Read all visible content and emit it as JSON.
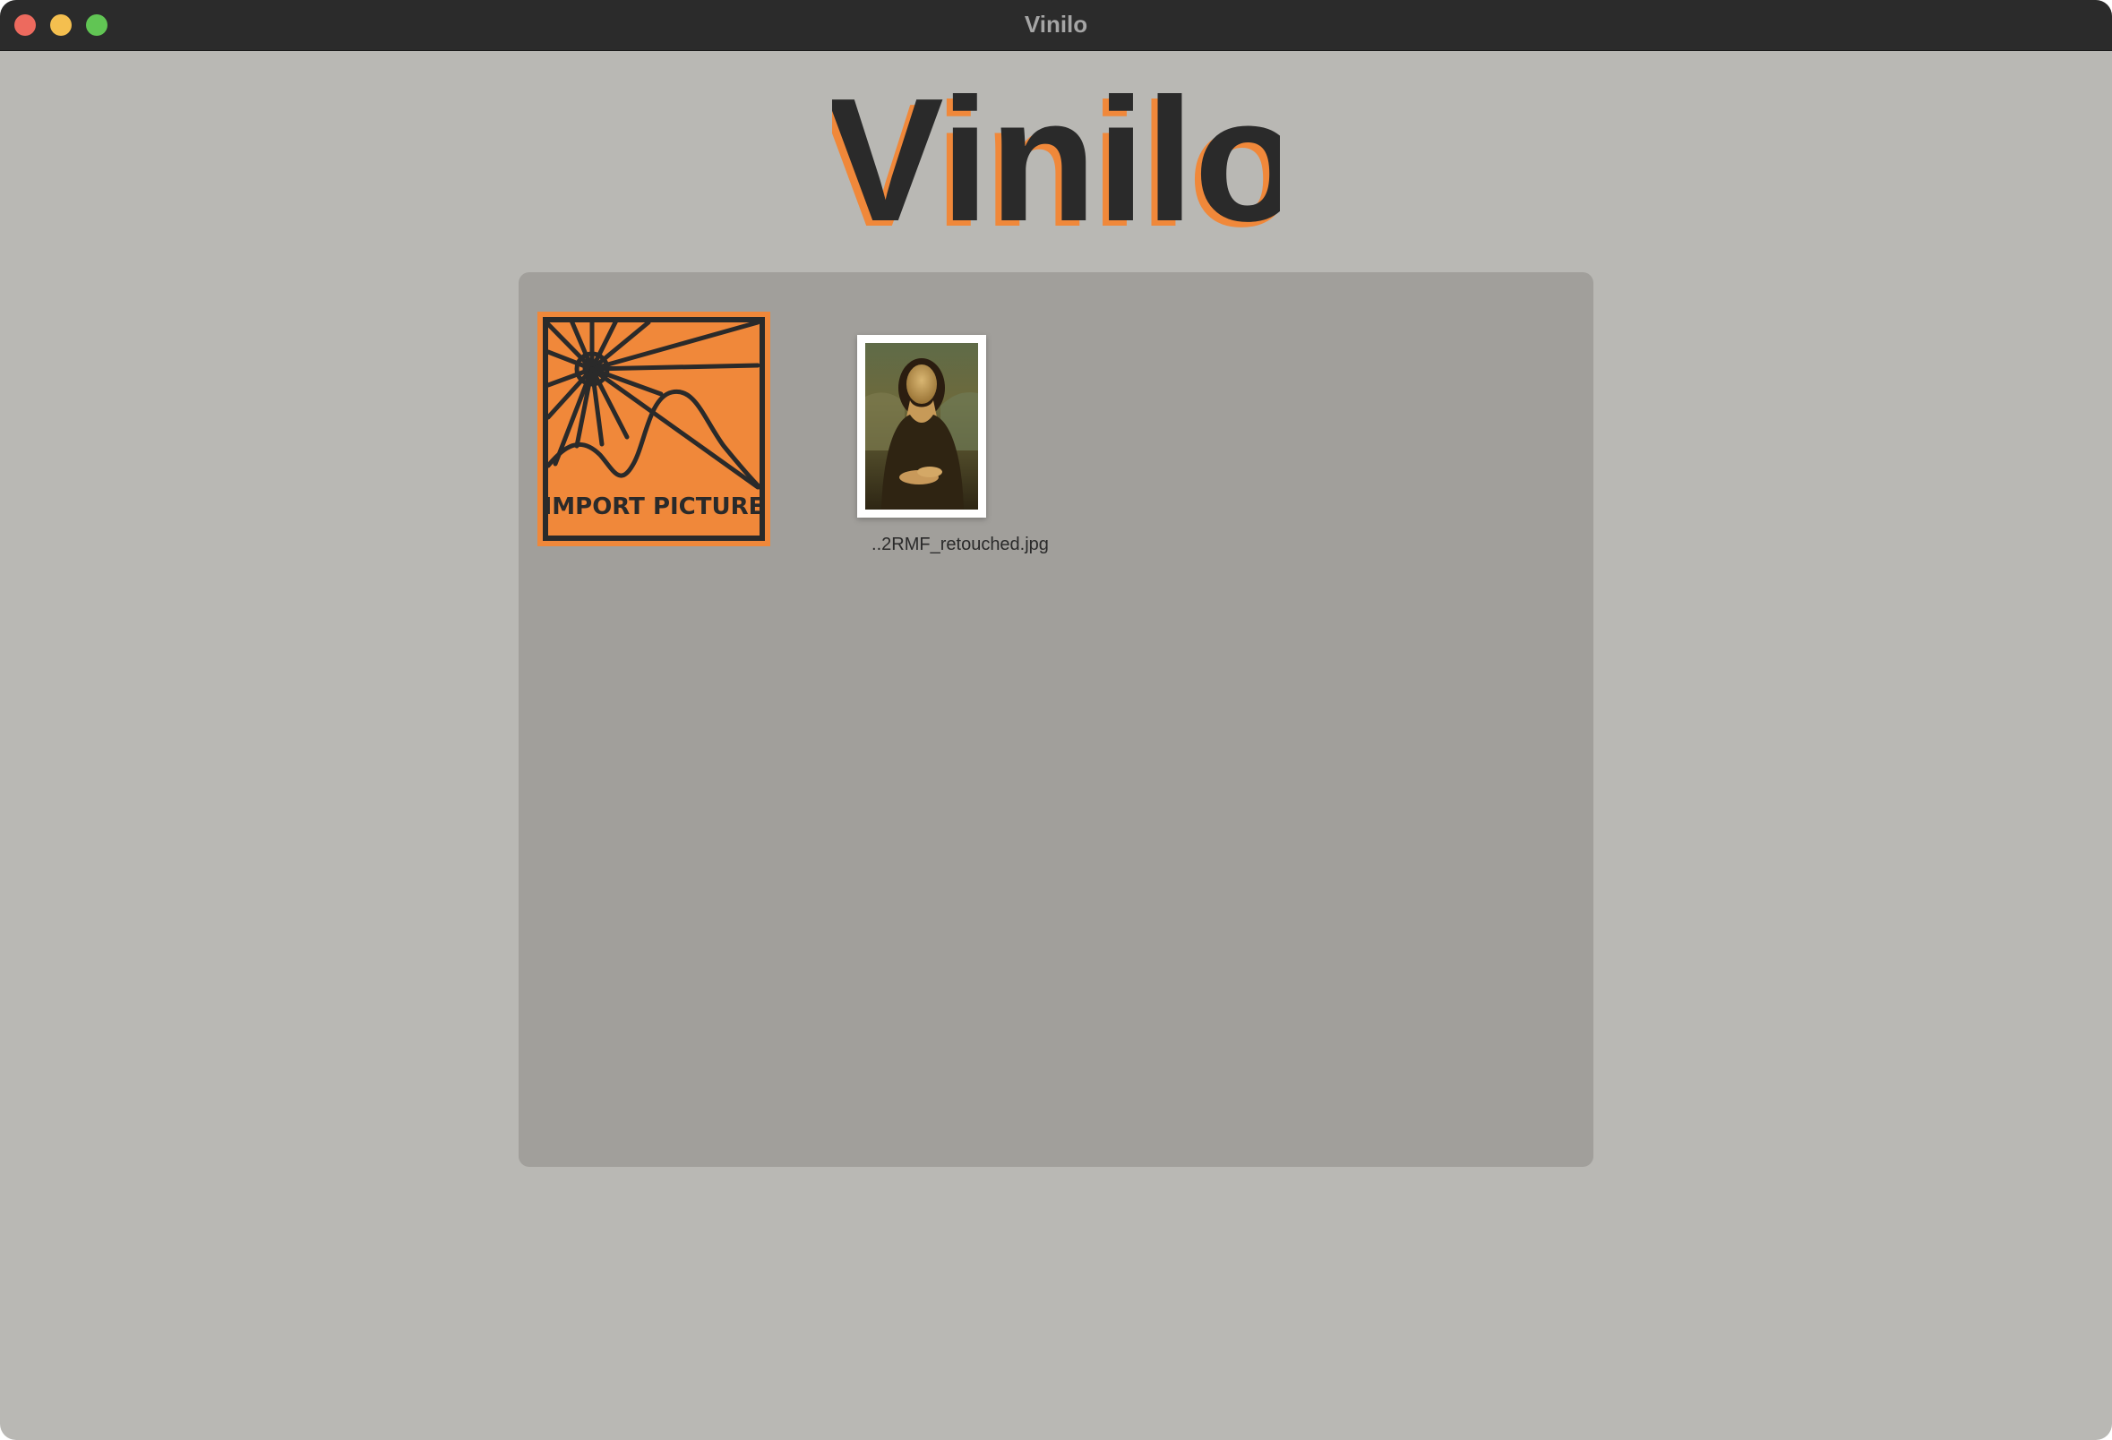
{
  "window": {
    "title": "Vinilo"
  },
  "header": {
    "logo_text": "Vinilo"
  },
  "library": {
    "import_button": {
      "label": "IMPORT PICTURE",
      "icon": "sun-mountain-icon"
    },
    "items": [
      {
        "filename": "..2RMF_retouched.jpg",
        "thumbnail": "mona-lisa-thumbnail"
      }
    ]
  },
  "colors": {
    "accent": "#f0883a",
    "ink": "#2a2a2a",
    "window_bg": "#b9b8b4",
    "panel_bg": "#a19f9b",
    "titlebar": "#2b2b2b"
  }
}
